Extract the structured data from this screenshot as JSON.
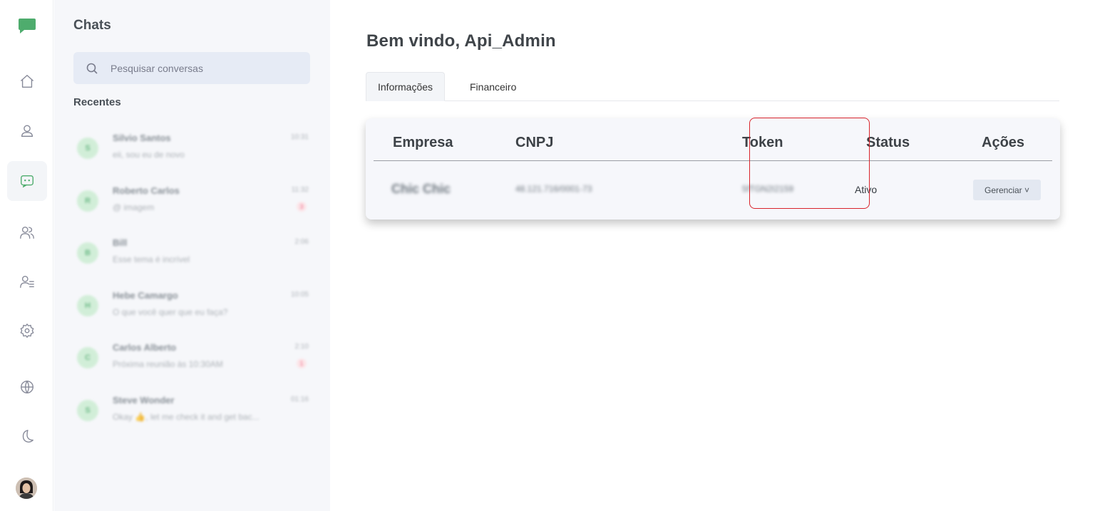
{
  "rail": {
    "logo_color": "#4eac6d",
    "icons": [
      "home-icon",
      "profile-icon",
      "chat-icon",
      "contacts-icon",
      "contact-list-icon",
      "settings-icon",
      "globe-icon",
      "moon-icon"
    ],
    "active_icon": "chat-icon"
  },
  "chats": {
    "title": "Chats",
    "search_placeholder": "Pesquisar conversas",
    "recent_label": "Recentes",
    "items": [
      {
        "initial": "S",
        "name": "Silvio Santos",
        "message": "eii, sou eu de novo",
        "time": "10:31",
        "badge": ""
      },
      {
        "initial": "R",
        "name": "Roberto Carlos",
        "message": "@ imagem",
        "time": "11:32",
        "badge": "3"
      },
      {
        "initial": "B",
        "name": "Bill",
        "message": "Esse tema é incrível",
        "time": "2:06",
        "badge": ""
      },
      {
        "initial": "H",
        "name": "Hebe Camargo",
        "message": "O que você quer que eu faça?",
        "time": "10:05",
        "badge": ""
      },
      {
        "initial": "C",
        "name": "Carlos Alberto",
        "message": "Próxima reunião às 10:30AM",
        "time": "2:10",
        "badge": "1"
      },
      {
        "initial": "S",
        "name": "Steve Wonder",
        "message": "Okay 👍, let me check it and get bac...",
        "time": "01:16",
        "badge": ""
      }
    ]
  },
  "main": {
    "welcome": "Bem vindo, Api_Admin",
    "tabs": [
      {
        "label": "Informações",
        "active": true
      },
      {
        "label": "Financeiro",
        "active": false
      }
    ],
    "table": {
      "headers": {
        "empresa": "Empresa",
        "cnpj": "CNPJ",
        "token": "Token",
        "status": "Status",
        "acoes": "Ações"
      },
      "row": {
        "empresa": "Chic Chic",
        "cnpj": "48.121.716/0001-73",
        "token": "5fTGN2I2159",
        "status": "Ativo",
        "action": "Gerenciar ˅"
      }
    },
    "highlight_color": "#d9242c"
  }
}
